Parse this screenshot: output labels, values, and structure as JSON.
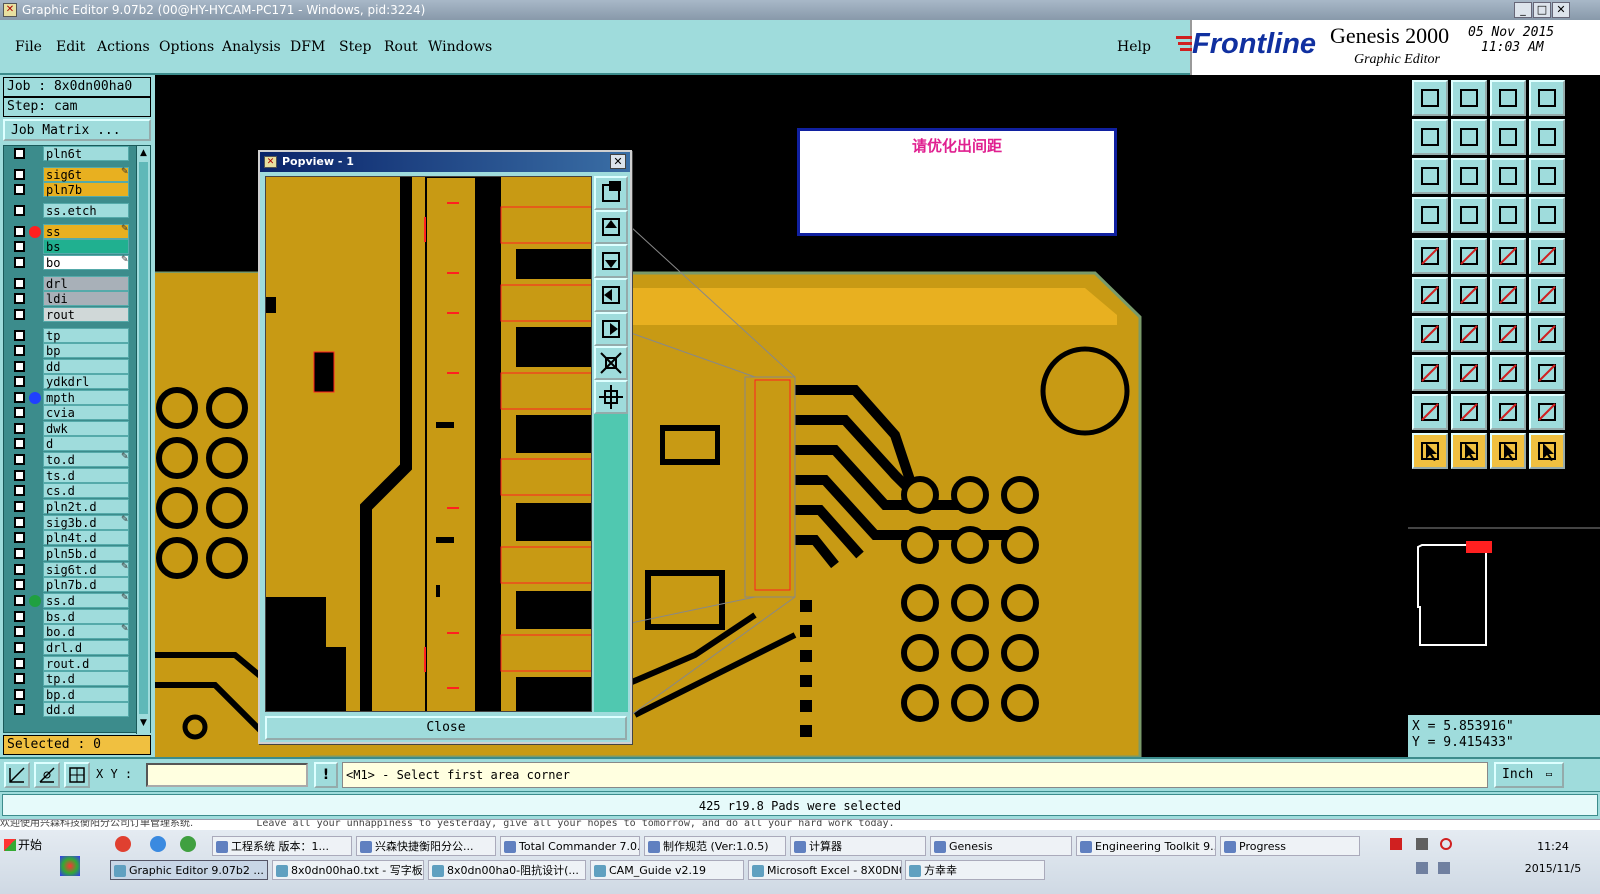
{
  "window": {
    "title": "Graphic Editor 9.07b2 (00@HY-HYCAM-PC171 - Windows, pid:3224)"
  },
  "menu": {
    "items": [
      "File",
      "Edit",
      "Actions",
      "Options",
      "Analysis",
      "DFM",
      "Step",
      "Rout",
      "Windows"
    ],
    "help": "Help"
  },
  "brand": {
    "logo": "Frontline",
    "product": "Genesis 2000",
    "subtitle": "Graphic Editor",
    "date": "05 Nov 2015",
    "time": "11:03 AM"
  },
  "left_panel": {
    "job": "Job : 8x0dn00ha0",
    "step": "Step: cam",
    "job_matrix_button": "Job Matrix ...",
    "selected": "Selected : 0",
    "layers": [
      {
        "name": "pln6t",
        "color": "#9fdcdc",
        "dot": ""
      },
      {
        "name": "sig6t",
        "color": "#e8b020",
        "dot": "",
        "pen": true
      },
      {
        "name": "pln7b",
        "color": "#e8b020",
        "dot": ""
      },
      {
        "name": "ss.etch",
        "color": "#9fdcdc",
        "dot": ""
      },
      {
        "name": "ss",
        "color": "#e8b020",
        "dot": "#ff2020",
        "pen": true
      },
      {
        "name": "bs",
        "color": "#20b090",
        "dot": ""
      },
      {
        "name": "bo",
        "color": "#ffffff",
        "dot": "",
        "pen": true
      },
      {
        "name": "drl",
        "color": "#a8b0b8",
        "dot": ""
      },
      {
        "name": "ldi",
        "color": "#a8b0b8",
        "dot": ""
      },
      {
        "name": "rout",
        "color": "#d0d8d8",
        "dot": ""
      },
      {
        "name": "tp",
        "color": "#9fdcdc",
        "dot": ""
      },
      {
        "name": "bp",
        "color": "#9fdcdc",
        "dot": ""
      },
      {
        "name": "dd",
        "color": "#9fdcdc",
        "dot": ""
      },
      {
        "name": "ydkdrl",
        "color": "#9fdcdc",
        "dot": ""
      },
      {
        "name": "mpth",
        "color": "#9fdcdc",
        "dot": "#2040ff"
      },
      {
        "name": "cvia",
        "color": "#9fdcdc",
        "dot": ""
      },
      {
        "name": "dwk",
        "color": "#9fdcdc",
        "dot": ""
      },
      {
        "name": "d",
        "color": "#9fdcdc",
        "dot": ""
      },
      {
        "name": "to.d",
        "color": "#9fdcdc",
        "dot": "",
        "pen": true
      },
      {
        "name": "ts.d",
        "color": "#9fdcdc",
        "dot": ""
      },
      {
        "name": "cs.d",
        "color": "#9fdcdc",
        "dot": ""
      },
      {
        "name": "pln2t.d",
        "color": "#9fdcdc",
        "dot": ""
      },
      {
        "name": "sig3b.d",
        "color": "#9fdcdc",
        "dot": "",
        "pen": true
      },
      {
        "name": "pln4t.d",
        "color": "#9fdcdc",
        "dot": ""
      },
      {
        "name": "pln5b.d",
        "color": "#9fdcdc",
        "dot": ""
      },
      {
        "name": "sig6t.d",
        "color": "#9fdcdc",
        "dot": "",
        "pen": true
      },
      {
        "name": "pln7b.d",
        "color": "#9fdcdc",
        "dot": ""
      },
      {
        "name": "ss.d",
        "color": "#9fdcdc",
        "dot": "#20a040",
        "pen": true
      },
      {
        "name": "bs.d",
        "color": "#9fdcdc",
        "dot": ""
      },
      {
        "name": "bo.d",
        "color": "#9fdcdc",
        "dot": "",
        "pen": true
      },
      {
        "name": "drl.d",
        "color": "#9fdcdc",
        "dot": ""
      },
      {
        "name": "rout.d",
        "color": "#9fdcdc",
        "dot": ""
      },
      {
        "name": "tp.d",
        "color": "#9fdcdc",
        "dot": ""
      },
      {
        "name": "bp.d",
        "color": "#9fdcdc",
        "dot": ""
      },
      {
        "name": "dd.d",
        "color": "#9fdcdc",
        "dot": ""
      }
    ]
  },
  "note_box": {
    "text": "请优化出间距"
  },
  "popview": {
    "title": "Popview - 1",
    "close_button": "Close"
  },
  "coords": {
    "x": "X = 5.853916\"",
    "y": "Y = 9.415433\""
  },
  "status": {
    "xy_label": "X Y :",
    "xy_value": "",
    "prompt": "<M1> - Select first area corner",
    "units": "Inch",
    "message": "425 r19.8 Pads were selected"
  },
  "taskbar": {
    "start": "开始",
    "ticker_left": "欢迎使用兴森科技衡阳分公司订单管理系统.",
    "ticker_mid": "Leave all your unhappiness to yesterday, give all your hopes to tomorrow, and do all your hard work today.",
    "clock_time": "11:24",
    "clock_date": "2015/11/5",
    "row1": [
      "工程系统  版本：1...",
      "兴森快捷衡阳分公...",
      "Total Commander 7.0...",
      "制作规范 (Ver:1.0.5)",
      "计算器",
      "Genesis",
      "Engineering Toolkit 9....",
      "Progress"
    ],
    "row2": [
      "Graphic Editor 9.07b2 ...",
      "8x0dn00ha0.txt - 写字板",
      "8x0dn00ha0-阻抗设计(...",
      "CAM_Guide v2.19",
      "Microsoft Excel - 8X0DN0...",
      "方幸幸"
    ]
  }
}
